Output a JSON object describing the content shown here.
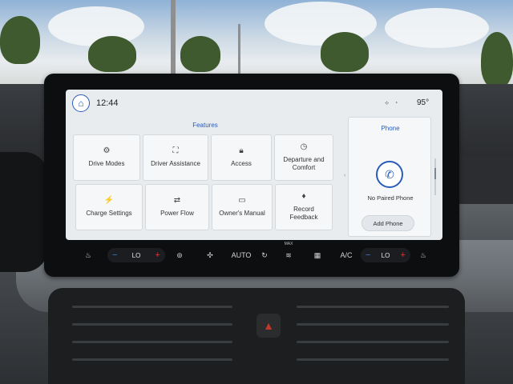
{
  "status_bar": {
    "time": "12:44",
    "temperature": "95°",
    "icons": [
      "home-icon",
      "signal-icon",
      "wifi-icon"
    ]
  },
  "features": {
    "title": "Features",
    "tiles": [
      {
        "label": "Drive Modes",
        "icon": "drive-modes-icon"
      },
      {
        "label": "Driver Assistance",
        "icon": "driver-assistance-icon"
      },
      {
        "label": "Access",
        "icon": "lock-icon"
      },
      {
        "label": "Departure and Comfort",
        "icon": "clock-icon"
      },
      {
        "label": "Charge Settings",
        "icon": "charge-settings-icon"
      },
      {
        "label": "Power Flow",
        "icon": "power-flow-icon"
      },
      {
        "label": "Owner's Manual",
        "icon": "book-icon"
      },
      {
        "label": "Record Feedback",
        "icon": "microphone-icon"
      }
    ]
  },
  "phone": {
    "title": "Phone",
    "status": "No Paired Phone",
    "add_button": "Add Phone",
    "icon": "phone-icon"
  },
  "climate": {
    "left_temp": "LO",
    "right_temp": "LO",
    "auto_label": "AUTO",
    "max_label": "MAX",
    "ac_label": "A/C",
    "colors": {
      "cool": "#3b7de0",
      "heat": "#d33b3b"
    }
  },
  "colors": {
    "accent": "#2a5bb8",
    "screen_bg": "#e9ecef"
  }
}
